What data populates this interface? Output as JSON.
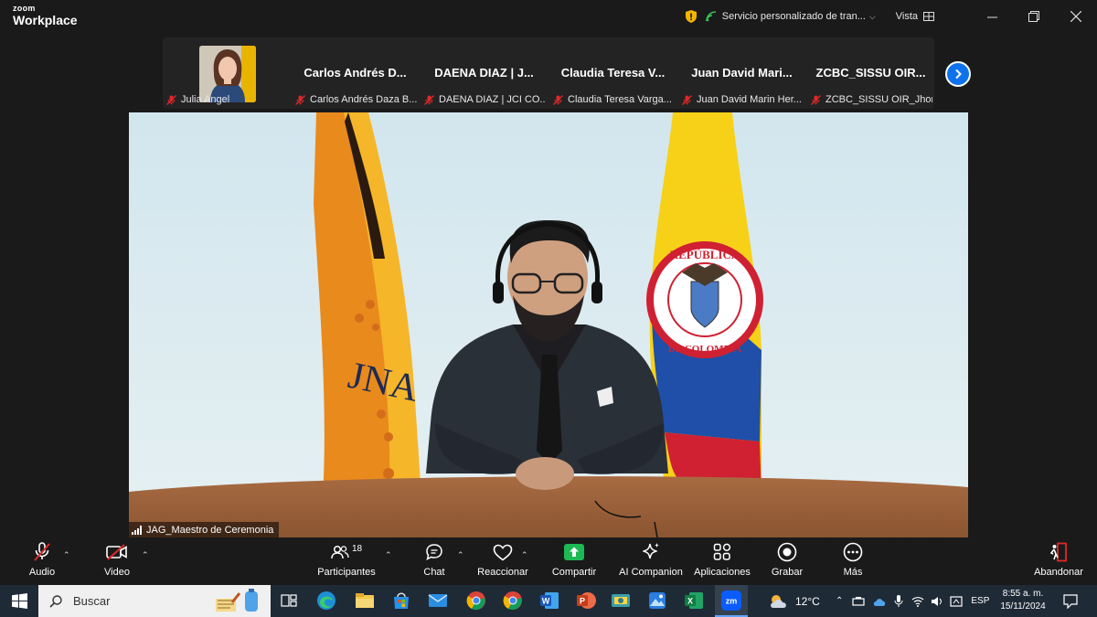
{
  "app": {
    "logo_top": "zoom",
    "logo_bottom": "Workplace"
  },
  "titlebar": {
    "service": "Servicio personalizado de tran...",
    "view": "Vista"
  },
  "participants": [
    {
      "name": "",
      "sub": "Julia Angel"
    },
    {
      "name": "Carlos Andrés D...",
      "sub": "Carlos Andrés Daza B..."
    },
    {
      "name": "DAENA DIAZ | J...",
      "sub": "DAENA DIAZ | JCI CO..."
    },
    {
      "name": "Claudia Teresa V...",
      "sub": "Claudia Teresa Varga..."
    },
    {
      "name": "Juan David Mari...",
      "sub": "Juan David Marin Her..."
    },
    {
      "name": "ZCBC_SISSU OIR...",
      "sub": "ZCBC_SISSU OIR_Jhon..."
    }
  ],
  "main_video": {
    "label": "JAG_Maestro de Ceremonia",
    "flag_seal_top": "REPÚBLICA",
    "flag_seal_bottom": "DE COLOMBIA"
  },
  "controls": {
    "audio": "Audio",
    "video": "Video",
    "participants": "Participantes",
    "participants_count": "18",
    "chat": "Chat",
    "react": "Reaccionar",
    "share": "Compartir",
    "ai": "AI Companion",
    "apps": "Aplicaciones",
    "record": "Grabar",
    "more": "Más",
    "leave": "Abandonar"
  },
  "taskbar": {
    "search": "Buscar",
    "weather": "12°C",
    "lang": "ESP",
    "time": "8:55 a. m.",
    "date": "15/11/2024"
  },
  "colors": {
    "accent": "#0e72ed",
    "share_green": "#1db954",
    "muted_red": "#e02828"
  }
}
